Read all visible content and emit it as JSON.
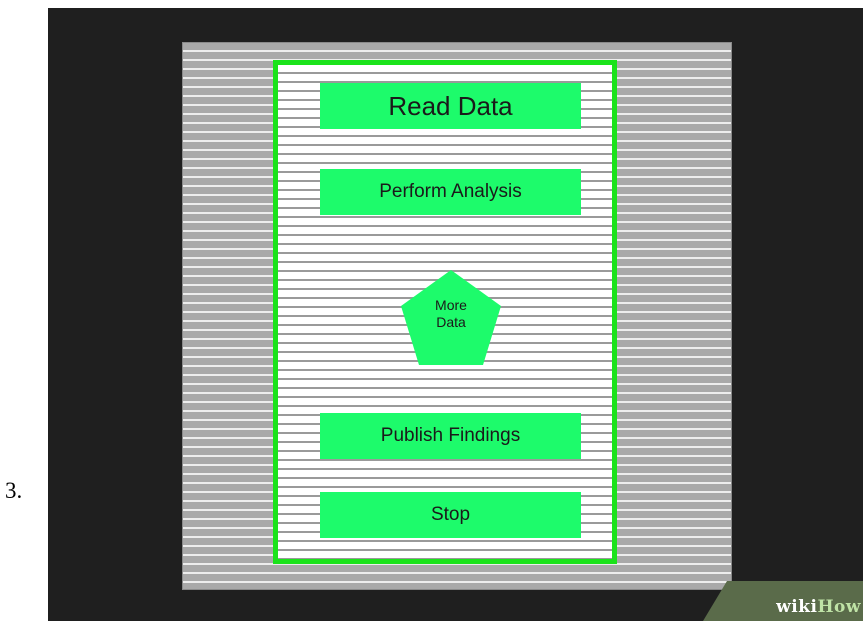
{
  "step": {
    "number": "3."
  },
  "diagram": {
    "boxes": [
      {
        "label": "Read Data"
      },
      {
        "label": "Perform Analysis"
      },
      {
        "label": "Publish Findings"
      },
      {
        "label": "Stop"
      }
    ],
    "decision": {
      "line1": "More",
      "line2": "Data"
    },
    "colors": {
      "box_fill": "#1dfb6b",
      "sheet_border": "#1be31b",
      "frame_background": "#1f1f1f",
      "paper_background": "#a9a9a9"
    }
  },
  "watermark": {
    "part1": "wiki",
    "part2": "How"
  }
}
